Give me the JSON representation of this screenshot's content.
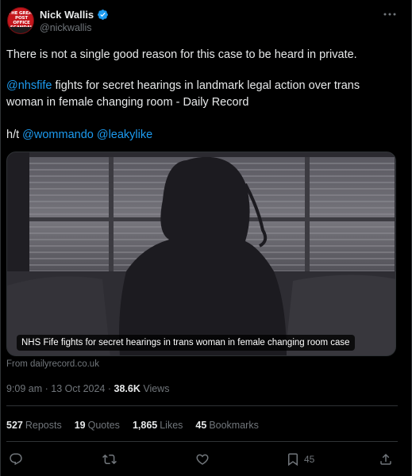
{
  "author": {
    "display_name": "Nick Wallis",
    "handle": "@nickwallis",
    "avatar_text": "THE GREAT POST OFFICE SCANDAL",
    "verified": true
  },
  "tweet": {
    "line1": "There is not a single good reason for this case to be heard in private.",
    "line2_mention": "@nhsfife",
    "line2_rest": " fights for secret hearings in landmark legal action over trans",
    "line3": "woman in female changing room - Daily Record",
    "line4_prefix": "h/t ",
    "line4_mention1": "@wommando",
    "line4_mention2": "@leakylike"
  },
  "card": {
    "caption": "NHS Fife fights for secret hearings in trans woman in female changing room case",
    "source": "From dailyrecord.co.uk"
  },
  "meta": {
    "time": "9:09 am",
    "date": "13 Oct 2024",
    "separator": " · ",
    "views_count": "38.6K",
    "views_label": " Views"
  },
  "stats": {
    "reposts_count": "527",
    "reposts_label": "Reposts",
    "quotes_count": "19",
    "quotes_label": "Quotes",
    "likes_count": "1,865",
    "likes_label": "Likes",
    "bookmarks_count": "45",
    "bookmarks_label": "Bookmarks"
  },
  "actions": {
    "reply_icon": "reply-icon",
    "repost_icon": "repost-icon",
    "like_icon": "heart-icon",
    "bookmark_icon": "bookmark-icon",
    "bookmark_count": "45",
    "share_icon": "share-icon"
  },
  "colors": {
    "background": "#000000",
    "text": "#e7e9ea",
    "secondary": "#71767b",
    "accent": "#1d9bf0",
    "divider": "#2f3336"
  }
}
